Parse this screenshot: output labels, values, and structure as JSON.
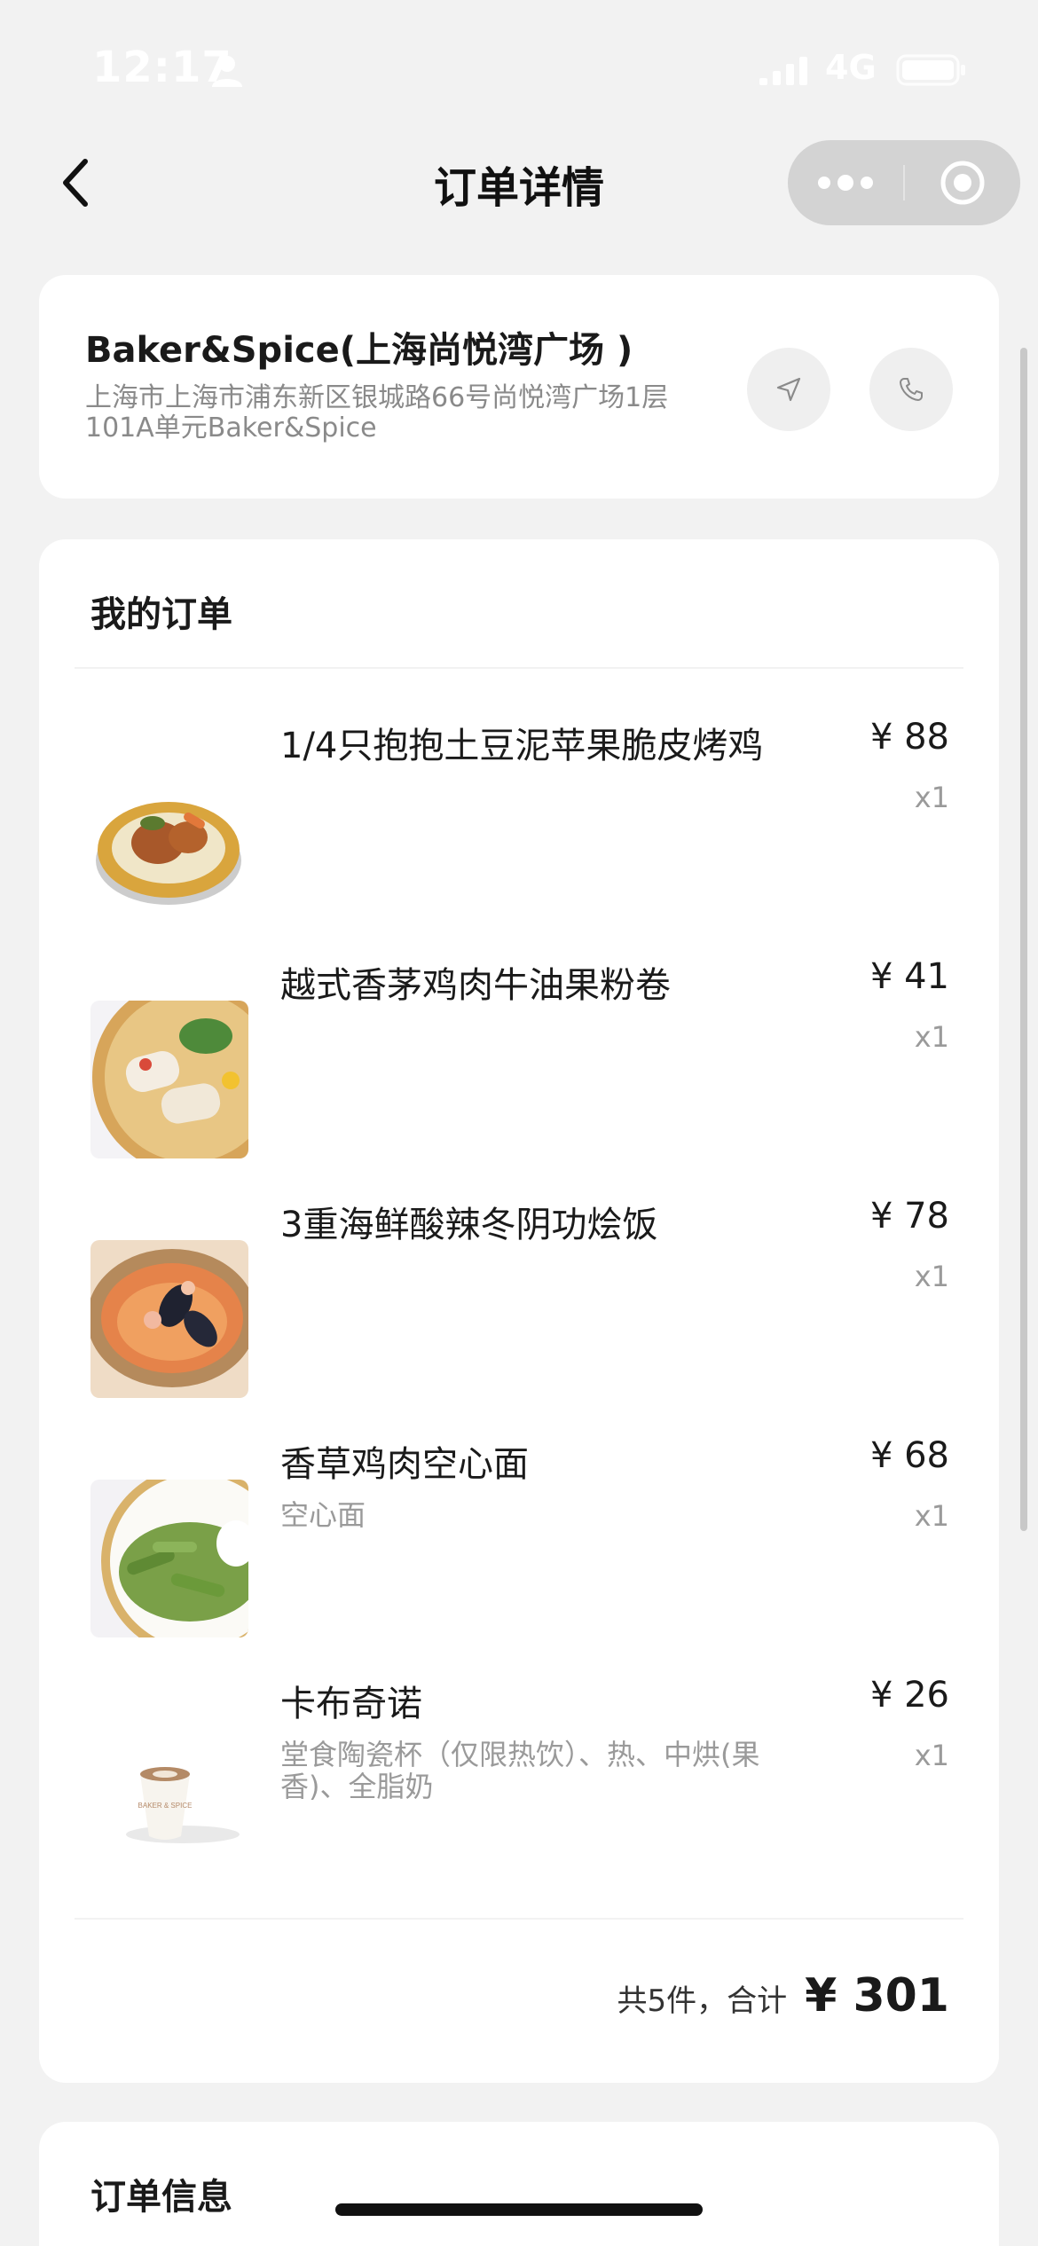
{
  "status_bar": {
    "time": "12:17",
    "network": "4G"
  },
  "nav": {
    "title": "订单详情"
  },
  "store": {
    "name": "Baker&Spice(上海尚悦湾广场 )",
    "address": "上海市上海市浦东新区银城路66号尚悦湾广场1层101A单元Baker&Spice"
  },
  "order": {
    "heading": "我的订单",
    "items": [
      {
        "name": "1/4只抱抱土豆泥苹果脆皮烤鸡",
        "desc": "",
        "price": "¥ 88",
        "qty": "x1"
      },
      {
        "name": "越式香茅鸡肉牛油果粉卷",
        "desc": "",
        "price": "¥ 41",
        "qty": "x1"
      },
      {
        "name": "3重海鲜酸辣冬阴功烩饭",
        "desc": "",
        "price": "¥ 78",
        "qty": "x1"
      },
      {
        "name": "香草鸡肉空心面",
        "desc": "空心面",
        "price": "¥ 68",
        "qty": "x1"
      },
      {
        "name": "卡布奇诺",
        "desc": "堂食陶瓷杯（仅限热饮）、热、中烘(果香)、全脂奶",
        "price": "¥ 26",
        "qty": "x1"
      }
    ],
    "summary_count": "共5件，合计",
    "summary_total": "¥ 301"
  },
  "info": {
    "heading": "订单信息"
  },
  "cup_logo": "BAKER & SPICE",
  "colors": {
    "background": "#f2f2f2",
    "card": "#ffffff",
    "muted_text": "#9a9a9a",
    "capsule": "#d3d3d3"
  },
  "icons": {
    "back": "chevron-left-icon",
    "more": "more-dots-icon",
    "close": "target-circle-icon",
    "navigate": "navigation-arrow-icon",
    "phone": "phone-icon"
  }
}
